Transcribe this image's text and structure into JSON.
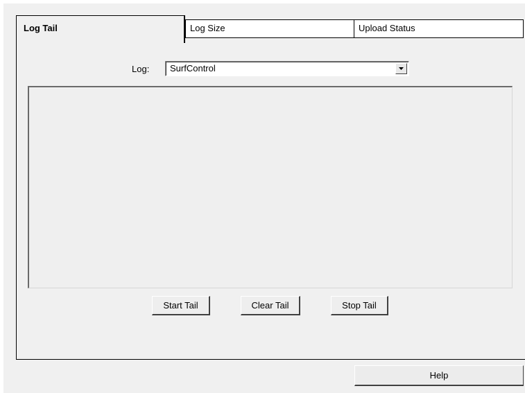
{
  "tabs": [
    {
      "label": "Log Tail",
      "active": true
    },
    {
      "label": "Log Size",
      "active": false
    },
    {
      "label": "Upload Status",
      "active": false
    }
  ],
  "log_selector": {
    "label": "Log:",
    "selected_value": "SurfControl",
    "icon": "chevron-down-icon"
  },
  "log_output": {
    "content": ""
  },
  "buttons": {
    "start_tail": "Start Tail",
    "clear_tail": "Clear Tail",
    "stop_tail": "Stop Tail",
    "help": "Help"
  }
}
